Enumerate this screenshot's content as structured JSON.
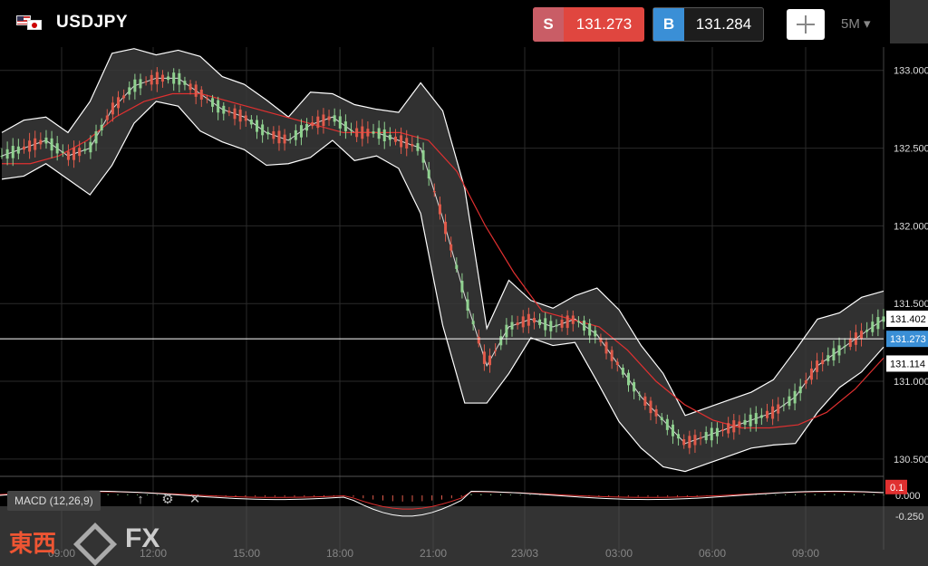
{
  "header": {
    "symbol": "USDJPY",
    "sell_label": "S",
    "sell_price": "131.273",
    "buy_label": "B",
    "buy_price": "131.284",
    "timeframe": "5M"
  },
  "indicator": {
    "macd_label": "MACD (12,26,9)",
    "macd_value_tag": "0.1"
  },
  "logo": {
    "text_jp": "東西",
    "text_fx": "FX"
  },
  "colors": {
    "sell": "#e0463f",
    "buy": "#3a8fd6",
    "bull": "#8fd18f",
    "bear": "#e05a4a",
    "ma": "#e03030",
    "band": "#ffffff"
  },
  "chart_data": {
    "type": "candlestick",
    "x_ticks": [
      "09:00",
      "12:00",
      "15:00",
      "18:00",
      "21:00",
      "23/03",
      "03:00",
      "06:00",
      "09:00"
    ],
    "y_ticks": [
      "133.000",
      "132.500",
      "132.000",
      "131.500",
      "131.000",
      "130.500"
    ],
    "ylim": [
      130.4,
      133.15
    ],
    "price_labels": [
      "131.402",
      "131.273",
      "131.114"
    ],
    "macd_ticks": [
      "0.000",
      "-0.250"
    ],
    "close_path": [
      132.45,
      132.5,
      132.55,
      132.45,
      132.5,
      132.75,
      132.9,
      132.95,
      132.95,
      132.85,
      132.75,
      132.7,
      132.6,
      132.55,
      132.65,
      132.7,
      132.6,
      132.6,
      132.55,
      132.5,
      132.05,
      131.55,
      131.1,
      131.35,
      131.4,
      131.35,
      131.4,
      131.3,
      131.1,
      130.9,
      130.75,
      130.6,
      130.65,
      130.7,
      130.75,
      130.8,
      130.9,
      131.1,
      131.2,
      131.3,
      131.4
    ],
    "ma_path": [
      132.4,
      132.4,
      132.45,
      132.55,
      132.7,
      132.8,
      132.85,
      132.85,
      132.8,
      132.75,
      132.7,
      132.65,
      132.6,
      132.6,
      132.6,
      132.55,
      132.35,
      132.0,
      131.7,
      131.45,
      131.4,
      131.35,
      131.2,
      131.0,
      130.85,
      130.75,
      130.7,
      130.7,
      130.72,
      130.8,
      130.95,
      131.15
    ],
    "grid": true
  }
}
